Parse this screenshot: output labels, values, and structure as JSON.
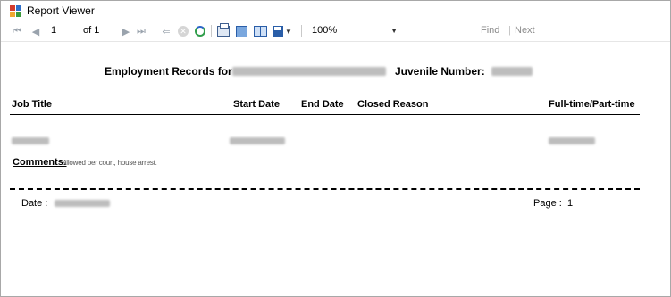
{
  "window": {
    "title": "Report Viewer"
  },
  "toolbar": {
    "page_current": "1",
    "page_of": "of 1",
    "zoom_value": "100%",
    "find_label": "Find",
    "find_separator": "|",
    "next_label": "Next"
  },
  "report": {
    "header_prefix": "Employment Records for",
    "header_juvenile_label": "Juvenile Number:",
    "columns": [
      "Job Title",
      "Start Date",
      "End Date",
      "Closed Reason",
      "Full-time/Part-time"
    ],
    "comments_label": "Comments:",
    "comments_value": "allowed per court, house arrest.",
    "date_label": "Date :",
    "page_label": "Page :",
    "page_number": "1"
  }
}
